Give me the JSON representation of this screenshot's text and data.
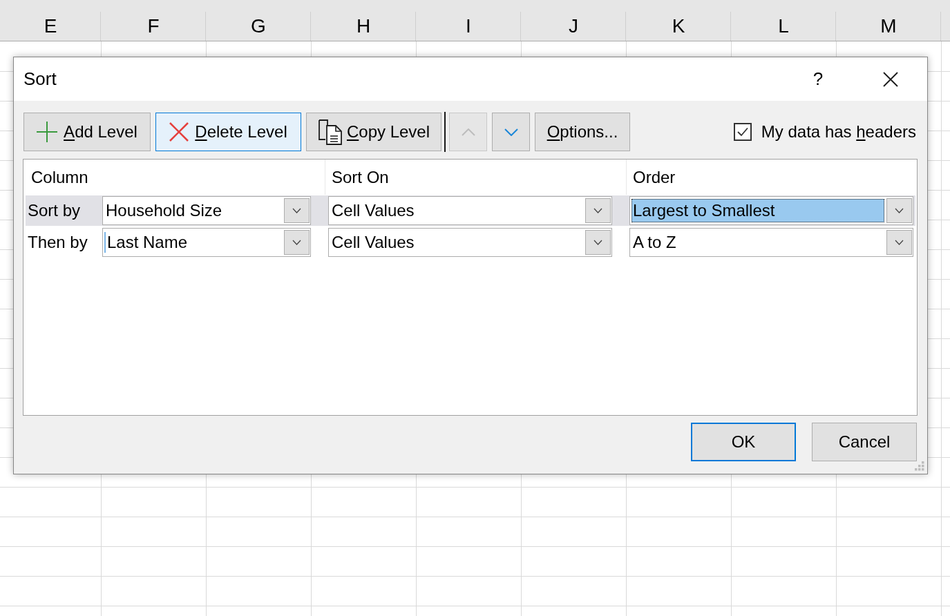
{
  "sheet": {
    "columns": [
      "E",
      "F",
      "G",
      "H",
      "I",
      "J",
      "K",
      "L",
      "M"
    ]
  },
  "dialog": {
    "title": "Sort",
    "help": "?",
    "toolbar": [
      {
        "kind": "add",
        "label": "Add Level",
        "underline_first_letter": true,
        "highlighted": false,
        "disabled": false
      },
      {
        "kind": "delete",
        "label": "Delete Level",
        "underline_first_letter": true,
        "highlighted": true,
        "disabled": false
      },
      {
        "kind": "copy",
        "label": "Copy Level",
        "underline_first_letter": true,
        "highlighted": false,
        "disabled": false
      },
      {
        "kind": "separator"
      },
      {
        "kind": "move_up",
        "highlighted": false,
        "disabled": true
      },
      {
        "kind": "move_down",
        "highlighted": false,
        "disabled": false
      },
      {
        "kind": "options",
        "label": "Options...",
        "underline_first_letter": true,
        "highlighted": false,
        "disabled": false
      }
    ],
    "headers_checkbox": {
      "label": "My data has headers",
      "underline_last_word": true,
      "checked": true
    },
    "columns": [
      "Column",
      "Sort On",
      "Order"
    ],
    "levels": [
      {
        "label": "Sort by",
        "selected": true,
        "column": {
          "value": "Household Size",
          "focused": false,
          "caret": false
        },
        "sort_on": {
          "value": "Cell Values",
          "focused": false,
          "caret": false
        },
        "order": {
          "value": "Largest to Smallest",
          "focused": true,
          "caret": false
        }
      },
      {
        "label": "Then by",
        "selected": false,
        "column": {
          "value": "Last Name",
          "focused": false,
          "caret": true
        },
        "sort_on": {
          "value": "Cell Values",
          "focused": false,
          "caret": false
        },
        "order": {
          "value": "A to Z",
          "focused": false,
          "caret": false
        }
      }
    ],
    "buttons": [
      {
        "label": "OK",
        "default": true
      },
      {
        "label": "Cancel",
        "default": false
      }
    ]
  }
}
